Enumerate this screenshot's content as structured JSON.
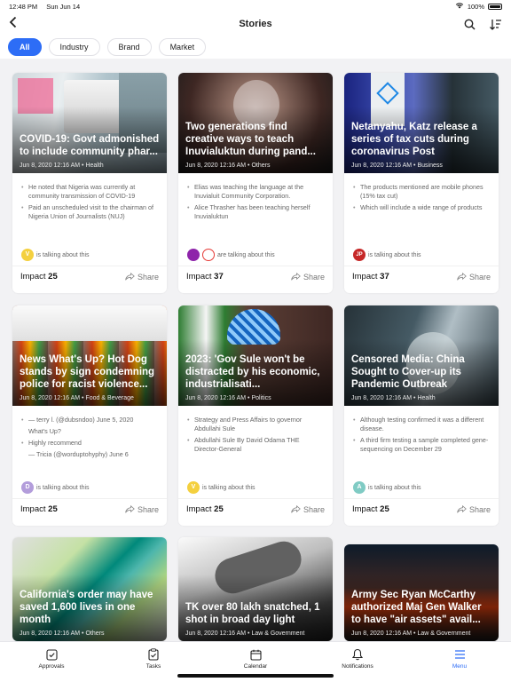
{
  "status": {
    "time": "12:48 PM",
    "date": "Sun Jun 14",
    "battery": "100%"
  },
  "nav": {
    "title": "Stories"
  },
  "filters": [
    "All",
    "Industry",
    "Brand",
    "Market"
  ],
  "cards": [
    {
      "headline": "COVID-19: Govt admonished to include community phar...",
      "meta": "Jun 8, 2020 12:16 AM • Health",
      "bullets": [
        "He noted that Nigeria was currently at community transmission of COVID-19",
        "Paid an unscheduled visit to the chairman of Nigeria Union of Journalists (NUJ)"
      ],
      "avatars": [
        "V"
      ],
      "talk": "is talking about this",
      "impact_label": "Impact",
      "impact": "25",
      "share": "Share"
    },
    {
      "headline": "Two generations find creative ways to teach Inuvialuktun during pand...",
      "meta": "Jun 8, 2020 12:16 AM • Others",
      "bullets": [
        "Elias was teaching the language at the Inuvialuit Community Corporation.",
        "Alice Thrasher has been teaching herself Inuvialuktun"
      ],
      "avatars": [
        "",
        ""
      ],
      "talk": "are talking about this",
      "impact_label": "Impact",
      "impact": "37",
      "share": "Share"
    },
    {
      "headline": "Netanyahu, Katz release a series of tax cuts during coronavirus Post",
      "meta": "Jun 8, 2020 12:16 AM • Business",
      "bullets": [
        "The products mentioned are mobile phones (15% tax cut)",
        "Which will include a wide range of products"
      ],
      "avatars": [
        "JP"
      ],
      "talk": "is talking about this",
      "impact_label": "Impact",
      "impact": "37",
      "share": "Share"
    },
    {
      "headline": "News What's Up? Hot Dog stands by sign condemning police for racist violence...",
      "meta": "Jun 8, 2020 12:16 AM • Food & Beverage",
      "bullets": [
        "— terry l. (@dubsndoo) June 5, 2020",
        "What's Up?",
        "Highly recommend",
        "— Tricia (@worduptohyphy) June 6"
      ],
      "avatars": [
        "D"
      ],
      "talk": "is talking about this",
      "impact_label": "Impact",
      "impact": "25",
      "share": "Share"
    },
    {
      "headline": "2023: 'Gov Sule won't be distracted by his economic, industrialisati...",
      "meta": "Jun 8, 2020 12:16 AM • Politics",
      "bullets": [
        "Strategy and Press Affairs to governor Abdullahi Sule",
        "Abdullahi Sule By David Odama THE Director-General"
      ],
      "avatars": [
        "V"
      ],
      "talk": "is talking about this",
      "impact_label": "Impact",
      "impact": "25",
      "share": "Share"
    },
    {
      "headline": "Censored Media: China Sought to Cover-up its Pandemic Outbreak",
      "meta": "Jun 8, 2020 12:16 AM • Health",
      "bullets": [
        "Although testing confirmed it was a different disease.",
        "A third firm testing a sample completed gene-sequencing on December 29"
      ],
      "avatars": [
        "A"
      ],
      "talk": "is talking about this",
      "impact_label": "Impact",
      "impact": "25",
      "share": "Share"
    },
    {
      "headline": "California's order may have saved 1,600 lives in one month",
      "meta": "Jun 8, 2020 12:16 AM • Others"
    },
    {
      "headline": "TK over 80 lakh snatched, 1 shot in broad day light",
      "meta": "Jun 8, 2020 12:16 AM • Law & Government"
    },
    {
      "headline": "Army Sec Ryan McCarthy authorized Maj Gen Walker to have \"air assets\" avail...",
      "meta": "Jun 8, 2020 12:16 AM • Law & Government"
    }
  ],
  "tabs": [
    "Approvals",
    "Tasks",
    "Calendar",
    "Notifications",
    "Menu"
  ],
  "colors": {
    "accent": "#2d6df6"
  }
}
